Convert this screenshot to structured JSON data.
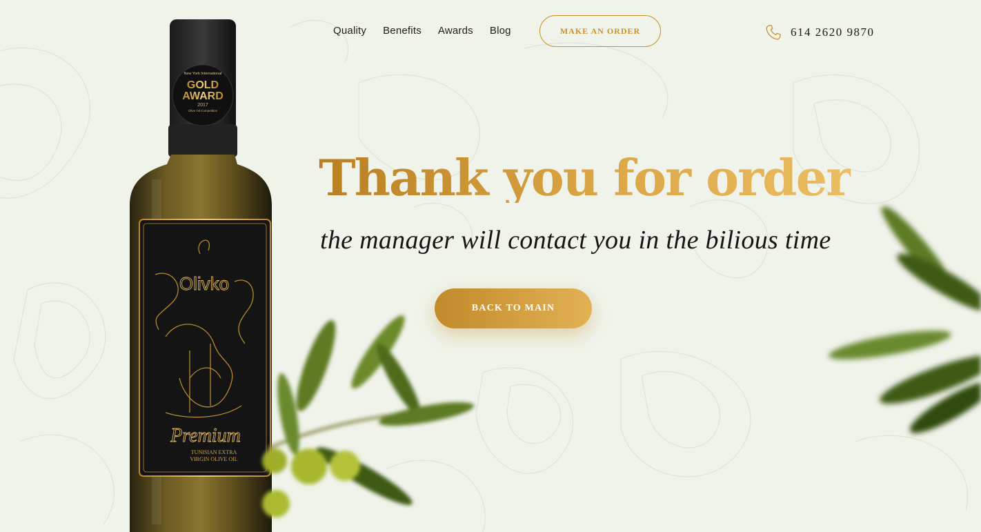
{
  "nav": {
    "items": [
      {
        "label": "Quality"
      },
      {
        "label": "Benefits"
      },
      {
        "label": "Awards"
      },
      {
        "label": "Blog"
      }
    ]
  },
  "header": {
    "order_button": "MAKE AN ORDER",
    "phone": "614 2620 9870",
    "phone_icon": "phone-icon"
  },
  "main": {
    "title": "Thank you for order",
    "subtitle": "the manager will contact you in the bilious time",
    "back_button": "BACK TO MAIN"
  },
  "bottle": {
    "award_line1": "New York International",
    "award_line2": "GOLD",
    "award_line3": "AWARD",
    "award_year": "2017",
    "award_line4": "Olive Oil Competition",
    "brand": "Olivko",
    "label_premium": "Premium",
    "label_line1": "TUNISIAN EXTRA",
    "label_line2": "VIRGIN OLIVE OIL"
  },
  "colors": {
    "background": "#eff3ea",
    "accent_gold": "#c9922e",
    "accent_gold_light": "#ebbd62",
    "text_dark": "#161616"
  }
}
